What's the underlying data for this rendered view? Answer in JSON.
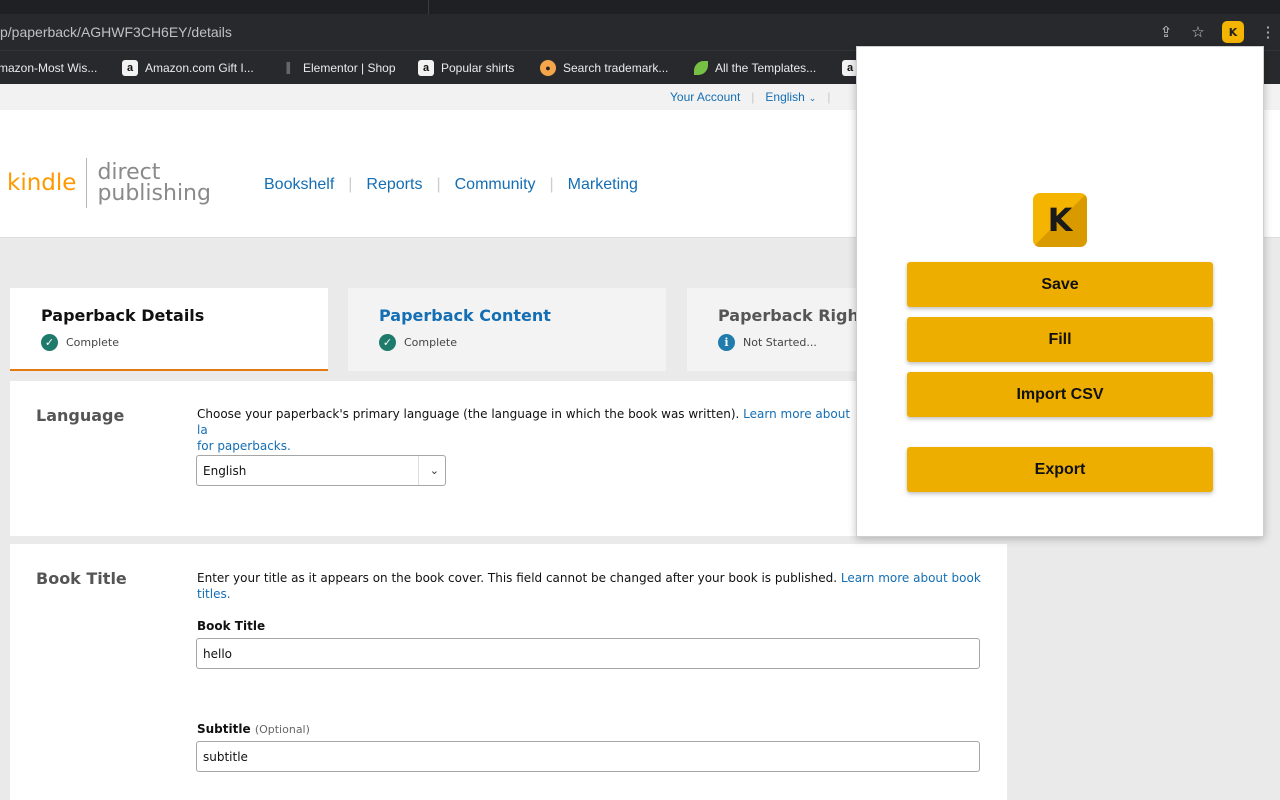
{
  "browser": {
    "url": "p/paperback/AGHWF3CH6EY/details",
    "bookmarks": [
      {
        "label": "mazon-Most Wis...",
        "icon": "none"
      },
      {
        "label": "Amazon.com Gift I...",
        "icon": "amazon-icon"
      },
      {
        "label": "Elementor | Shop",
        "icon": "elementor-icon"
      },
      {
        "label": "Popular shirts",
        "icon": "amazon-icon"
      },
      {
        "label": "Search trademark...",
        "icon": "pin-icon"
      },
      {
        "label": "All the Templates...",
        "icon": "leaf-icon"
      }
    ],
    "amazon_glyph": "a",
    "extension_glyph": "K"
  },
  "util_bar": {
    "account": "Your Account",
    "language": "English"
  },
  "header": {
    "logo_kindle": "kindle",
    "logo_direct": "direct",
    "logo_publishing": "publishing",
    "nav": [
      "Bookshelf",
      "Reports",
      "Community",
      "Marketing"
    ]
  },
  "steps": [
    {
      "title": "Paperback Details",
      "status": "Complete"
    },
    {
      "title": "Paperback Content",
      "status": "Complete"
    },
    {
      "title": "Paperback Right",
      "status": "Not Started..."
    }
  ],
  "language": {
    "heading": "Language",
    "desc": "Choose your paperback's primary language (the language in which the book was written). ",
    "link_part1": "Learn more about la",
    "link_part2": "for paperbacks.",
    "selected": "English"
  },
  "book_title": {
    "heading": "Book Title",
    "desc": "Enter your title as it appears on the book cover. This field cannot be changed after your book is published. ",
    "link": "Learn more about book titles.",
    "title_label": "Book Title",
    "title_value": "hello",
    "subtitle_label": "Subtitle",
    "subtitle_optional": "(Optional)",
    "subtitle_value": "subtitle"
  },
  "popup": {
    "logo_letter": "K",
    "buttons": {
      "save": "Save",
      "fill": "Fill",
      "import_csv": "Import CSV",
      "export": "Export"
    }
  },
  "colors": {
    "accent": "#eeae00",
    "link": "#146eb4",
    "kindle_orange": "#ff9900",
    "complete_green": "#1e7a6a"
  }
}
